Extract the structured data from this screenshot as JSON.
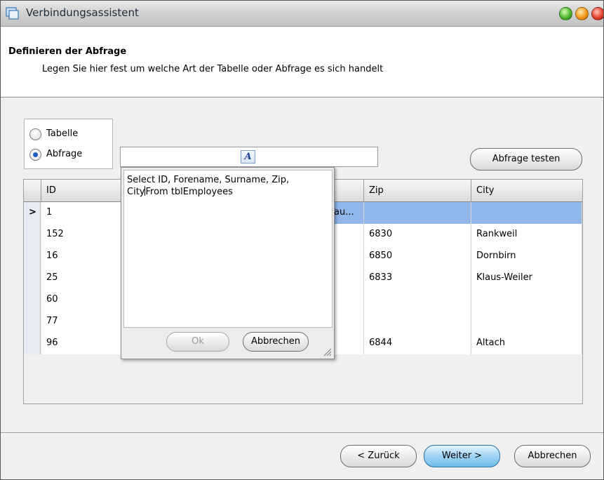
{
  "window": {
    "title": "Verbindungsassistent",
    "icon": "window-icon",
    "controls": [
      "minimize",
      "maximize",
      "close"
    ]
  },
  "header": {
    "title": "Definieren der Abfrage",
    "subtitle": "Legen Sie hier fest um welche Art der Tabelle oder Abfrage es sich handelt"
  },
  "source_type": {
    "options": [
      {
        "label": "Tabelle",
        "checked": false
      },
      {
        "label": "Abfrage",
        "checked": true
      }
    ]
  },
  "query_input": {
    "value": "",
    "icon": "font-icon"
  },
  "buttons": {
    "test_query": "Abfrage testen",
    "back": "< Zurück",
    "next": "Weiter >",
    "cancel": "Abbrechen"
  },
  "grid": {
    "columns": [
      "ID",
      "Zip",
      "City"
    ],
    "rows": [
      {
        "id": "1",
        "hidden": "au...",
        "zip": "",
        "city": "",
        "selected": true
      },
      {
        "id": "152",
        "zip": "6830",
        "city": "Rankweil"
      },
      {
        "id": "16",
        "zip": "6850",
        "city": "Dornbirn"
      },
      {
        "id": "25",
        "zip": "6833",
        "city": "Klaus-Weiler"
      },
      {
        "id": "60",
        "zip": "",
        "city": ""
      },
      {
        "id": "77",
        "zip": "",
        "city": ""
      },
      {
        "id": "96",
        "zip": "6844",
        "city": "Altach"
      }
    ]
  },
  "query_popup": {
    "text_before_caret": "Select ID, Forename, Surname, Zip,\nCity",
    "text_after_caret": "From tblEmployees",
    "ok": "Ok",
    "cancel": "Abbrechen",
    "ok_enabled": false
  }
}
